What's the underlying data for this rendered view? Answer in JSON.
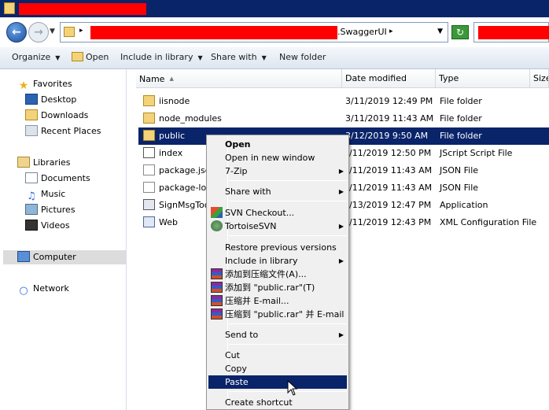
{
  "window": {
    "address_suffix": ".SwaggerUI"
  },
  "toolbar": {
    "organize": "Organize",
    "open": "Open",
    "include_in_library": "Include in library",
    "share_with": "Share with",
    "new_folder": "New folder"
  },
  "nav": {
    "favorites": "Favorites",
    "desktop": "Desktop",
    "downloads": "Downloads",
    "recent_places": "Recent Places",
    "libraries": "Libraries",
    "documents": "Documents",
    "music": "Music",
    "pictures": "Pictures",
    "videos": "Videos",
    "computer": "Computer",
    "network": "Network"
  },
  "columns": {
    "name": "Name",
    "date_modified": "Date modified",
    "type": "Type",
    "size": "Size"
  },
  "files": [
    {
      "name": "iisnode",
      "date": "3/11/2019 12:49 PM",
      "type": "File folder",
      "icon": "folder-icon"
    },
    {
      "name": "node_modules",
      "date": "3/11/2019 11:43 AM",
      "type": "File folder",
      "icon": "folder-icon"
    },
    {
      "name": "public",
      "date": "3/12/2019 9:50 AM",
      "type": "File folder",
      "icon": "folder-icon"
    },
    {
      "name": "index",
      "date": "/11/2019 12:50 PM",
      "type": "JScript Script File",
      "icon": "script-icon"
    },
    {
      "name": "package.json",
      "date": "/11/2019 11:43 AM",
      "type": "JSON File",
      "icon": "file-icon"
    },
    {
      "name": "package-lock",
      "date": "/11/2019 11:43 AM",
      "type": "JSON File",
      "icon": "file-icon"
    },
    {
      "name": "SignMsgTool",
      "date": "/13/2019 12:47 PM",
      "type": "Application",
      "icon": "app-icon"
    },
    {
      "name": "Web",
      "date": "/11/2019 12:43 PM",
      "type": "XML Configuration File",
      "icon": "xml-icon"
    }
  ],
  "context_menu": {
    "open": "Open",
    "open_new_window": "Open in new window",
    "seven_zip": "7-Zip",
    "share_with": "Share with",
    "svn_checkout": "SVN Checkout...",
    "tortoise_svn": "TortoiseSVN",
    "restore_versions": "Restore previous versions",
    "include_in_library": "Include in library",
    "rar_add_archive": "添加到压缩文件(A)...",
    "rar_add_public": "添加到 \"public.rar\"(T)",
    "rar_compress_email": "压缩并 E-mail...",
    "rar_compress_public_email": "压缩到 \"public.rar\" 并 E-mail",
    "send_to": "Send to",
    "cut": "Cut",
    "copy": "Copy",
    "paste": "Paste",
    "create_shortcut": "Create shortcut"
  },
  "colors": {
    "titlebar": "#0a246a",
    "selection": "#0a246a",
    "redaction": "#ff0000"
  }
}
